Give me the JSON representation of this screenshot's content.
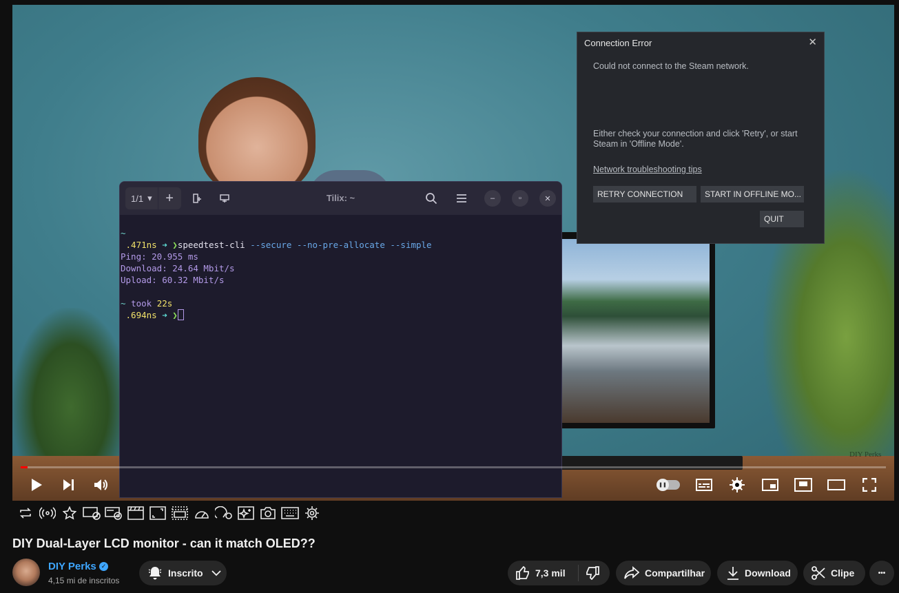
{
  "video": {
    "watermark": "DIY Perks",
    "progress_fraction": 0.008
  },
  "terminal": {
    "session": "1/1",
    "title": "Tilix: ~",
    "lines": {
      "l1_tilde": "~",
      "l2_time": ".471ns",
      "l2_arrow": "➜",
      "l2_prompt": "❯",
      "l2_cmd": "speedtest-cli",
      "l2_flags": "--secure --no-pre-allocate --simple",
      "l3": "Ping: 20.955 ms",
      "l4": "Download: 24.64 Mbit/s",
      "l5": "Upload: 60.32 Mbit/s",
      "l7_tilde": "~",
      "l7_took": "took",
      "l7_dur": "22s",
      "l8_time": ".694ns",
      "l8_arrow": "➜",
      "l8_prompt": "❯"
    }
  },
  "steam_dialog": {
    "title": "Connection Error",
    "close": "✕",
    "message": "Could not connect to the Steam network.",
    "message2": "Either check your connection and click 'Retry', or start Steam in 'Offline Mode'.",
    "link": "Network troubleshooting tips",
    "retry_label": "RETRY CONNECTION",
    "offline_label": "START IN OFFLINE MO...",
    "quit_label": "QUIT"
  },
  "meta": {
    "title": "DIY Dual-Layer LCD monitor - can it match OLED??",
    "channel": "DIY Perks",
    "verified": "✓",
    "subscribers": "4,15 mi de inscritos",
    "subscribe_label": "Inscrito",
    "likes": "7,3 mil",
    "share_label": "Compartilhar",
    "download_label": "Download",
    "clip_label": "Clipe",
    "more": "•••"
  }
}
